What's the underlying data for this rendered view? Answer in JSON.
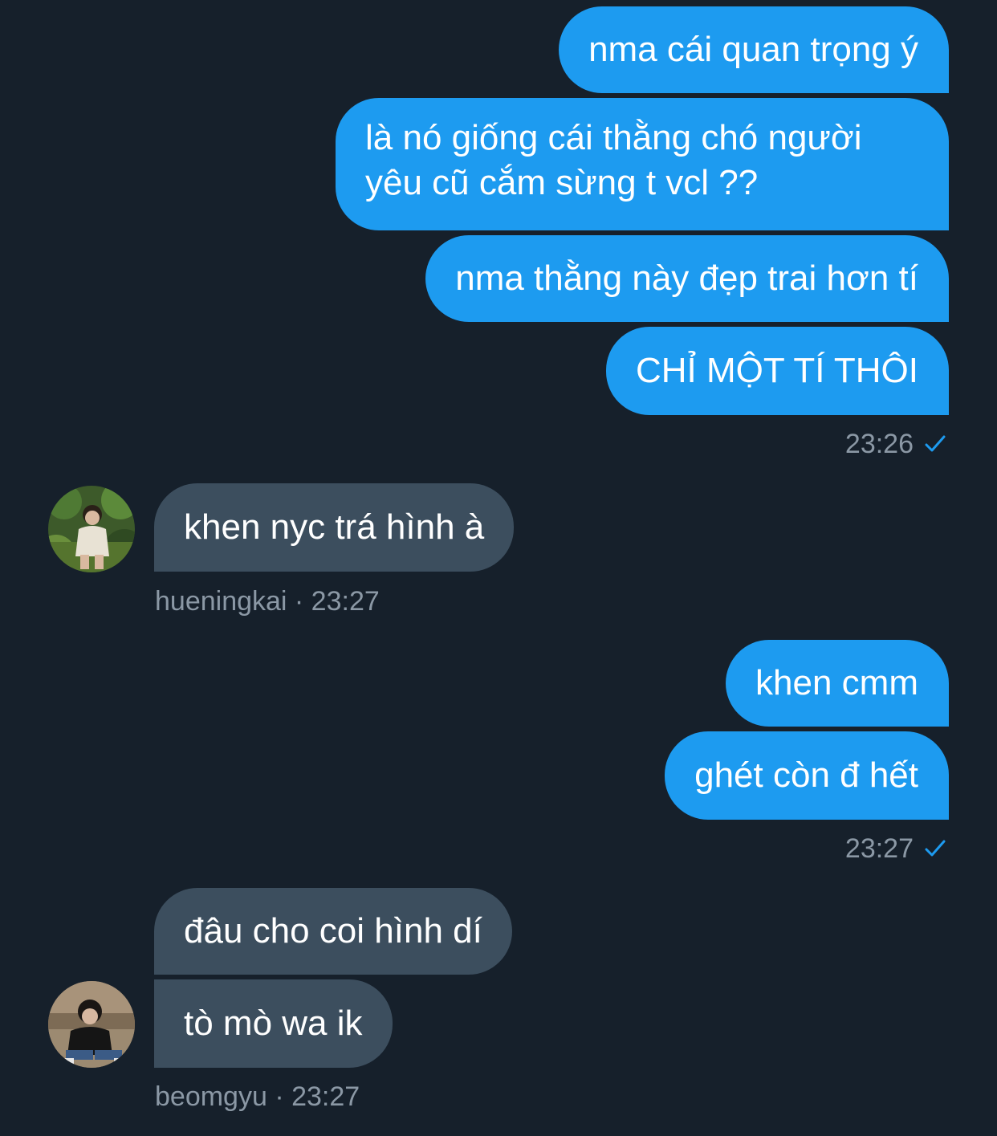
{
  "colors": {
    "background": "#16202b",
    "sent_bubble": "#1d9bf0",
    "received_bubble": "#3c4e5e",
    "meta_text": "#8b98a5",
    "read_check": "#1d9bf0"
  },
  "messages": {
    "sent_group_1": [
      "nma cái quan trọng ý",
      "là nó giống cái thằng chó người yêu cũ cắm sừng t vcl ??",
      "nma thằng này đẹp trai hơn tí",
      "CHỈ MỘT TÍ THÔI"
    ],
    "sent_group_1_time": "23:26",
    "received_group_1": [
      "khen nyc trá hình à"
    ],
    "received_group_1_meta": "hueningkai · 23:27",
    "sent_group_2": [
      "khen cmm",
      "ghét còn đ hết"
    ],
    "sent_group_2_time": "23:27",
    "received_group_2": [
      "đâu cho coi hình dí",
      "tò mò wa ik"
    ],
    "received_group_2_meta": "beomgyu · 23:27"
  },
  "icons": {
    "read_receipt": "checkmark-icon",
    "avatar_1": "avatar-hueningkai",
    "avatar_2": "avatar-beomgyu"
  }
}
